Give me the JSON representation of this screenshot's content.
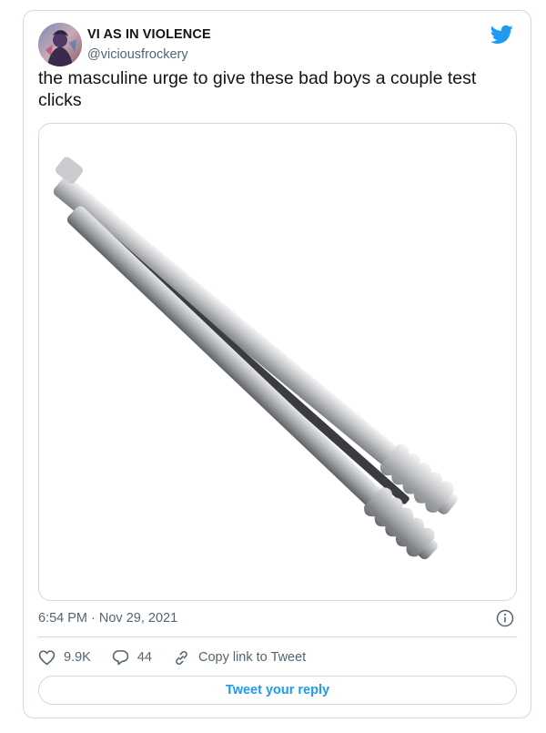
{
  "tweet": {
    "author_name": "VI AS IN VIOLENCE",
    "author_handle": "@viciousfrockery",
    "text": "the masculine urge to give these bad boys a couple test clicks",
    "timestamp": "6:54 PM · Nov 29, 2021"
  },
  "media": {
    "image_alt": "Stainless steel kitchen tongs"
  },
  "actions": {
    "likes": "9.9K",
    "replies": "44",
    "copy_link_label": "Copy link to Tweet"
  },
  "reply_button": {
    "label": "Tweet your reply"
  },
  "colors": {
    "brand": "#1d9bf0",
    "text_primary": "#0f1419",
    "text_secondary": "#536471",
    "border": "#cfd9de"
  },
  "icons": [
    "twitter-bird-icon",
    "info-icon",
    "heart-icon",
    "reply-icon",
    "link-icon"
  ]
}
